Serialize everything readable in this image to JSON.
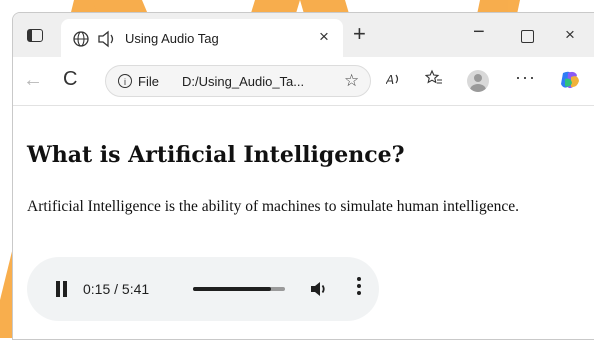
{
  "browser": {
    "tab_title": "Using Audio Tag",
    "url_scheme_label": "File",
    "url_text": "D:/Using_Audio_Ta...",
    "tab_close_glyph": "×",
    "new_tab_glyph": "+",
    "minimize_glyph": "−",
    "close_glyph": "×",
    "back_glyph": "←",
    "reload_glyph": "C",
    "star_glyph": "☆",
    "more_glyph": "···"
  },
  "page": {
    "heading": "What is Artificial Intelligence?",
    "paragraph": "Artificial Intelligence is the ability of machines to simulate human intelligence."
  },
  "audio_player": {
    "time_display": "0:15 / 5:41",
    "progress_fraction": 0.85
  },
  "colors": {
    "watermark": "#f7a53a",
    "player_bg": "#f1f3f4"
  },
  "icons": [
    "sidebar-icon",
    "globe-icon",
    "speaker-icon",
    "info-icon",
    "read-aloud-icon",
    "favorites-icon",
    "profile-icon",
    "copilot-icon",
    "pause-icon",
    "volume-icon",
    "more-options-icon"
  ]
}
